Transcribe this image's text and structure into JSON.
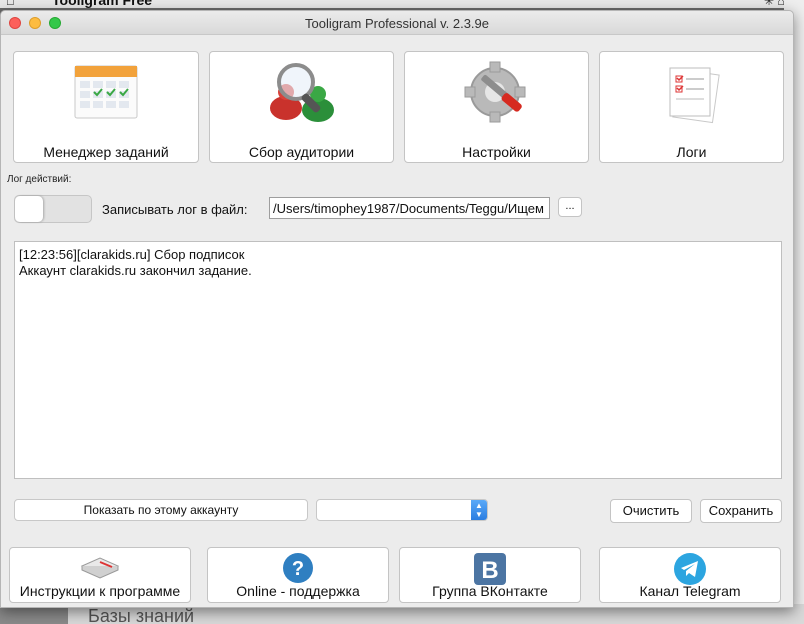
{
  "background_app": {
    "title": "Tooligram Free",
    "bottom_text": "Базы знаний"
  },
  "window": {
    "title": "Tooligram Professional v. 2.3.9e"
  },
  "tiles": [
    {
      "label": "Менеджер заданий",
      "icon": "calendar-icon"
    },
    {
      "label": "Сбор аудитории",
      "icon": "magnifier-people-icon"
    },
    {
      "label": "Настройки",
      "icon": "gear-tools-icon"
    },
    {
      "label": "Логи",
      "icon": "checklist-icon"
    }
  ],
  "log_section": {
    "label": "Лог действий:",
    "write_to_file_label": "Записывать лог в файл:",
    "file_path": "/Users/timophey1987/Documents/Teggu/Ищем l",
    "browse_label": "...",
    "lines": [
      "[12:23:56][clarakids.ru] Сбор подписок",
      "Аккаунт clarakids.ru закончил задание."
    ]
  },
  "controls": {
    "show_account_label": "Показать по этому аккаунту",
    "account_select_value": "",
    "clear_label": "Очистить",
    "save_label": "Сохранить"
  },
  "bottom_buttons": [
    {
      "label": "Инструкции к программе",
      "icon": "book-icon"
    },
    {
      "label": "Online - поддержка",
      "icon": "help-icon"
    },
    {
      "label": "Группа ВКонтакте",
      "icon": "vk-icon"
    },
    {
      "label": "Канал Telegram",
      "icon": "telegram-icon"
    }
  ],
  "colors": {
    "accent_blue": "#2a7de1",
    "vk_blue": "#4c75a3",
    "telegram_blue": "#2ca5e0",
    "help_blue": "#2f7fc1"
  }
}
